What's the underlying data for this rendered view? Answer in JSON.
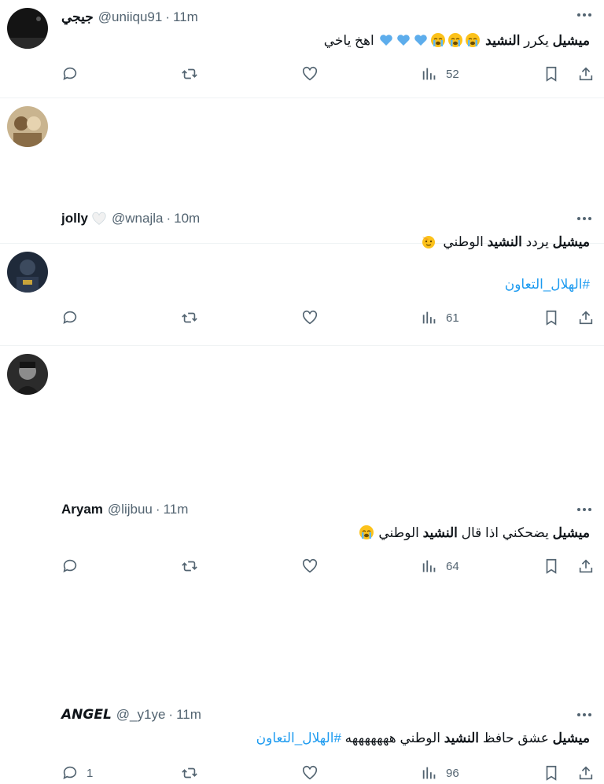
{
  "tweets": [
    {
      "name": "جيجي",
      "handle": "@uniiqu91",
      "time": "11m",
      "text_bold": "ميشيل",
      "text_mid": " يكرر ",
      "text_bold2": "النشيد",
      "text_tail": " اهخ ياخي",
      "emojis": [
        "crying-face-icon",
        "crying-face-icon",
        "crying-face-icon",
        "blue-heart-icon",
        "blue-heart-icon",
        "blue-heart-icon"
      ],
      "replies": "",
      "views": "52"
    },
    {
      "name": "jolly",
      "handle": "@wnajla",
      "time": "10m",
      "text_bold": "ميشيل",
      "text_mid": " يردد ",
      "text_bold2": "النشيد",
      "text_tail": " الوطني",
      "emojis": [
        "saluting-face-icon"
      ],
      "hashtag": "#الهلال_التعاون",
      "replies": "",
      "views": "61"
    },
    {
      "name": "Aryam",
      "handle": "@lijbuu",
      "time": "11m",
      "text_bold": "ميشيل",
      "text_mid": " يضحكني اذا قال ",
      "text_bold2": "النشيد",
      "text_tail": " الوطني",
      "emojis": [
        "crying-face-icon"
      ],
      "replies": "",
      "views": "64"
    },
    {
      "name": "𝘼𝙉𝙂𝙀𝙇",
      "handle": "@_y1ye",
      "time": "11m",
      "text_bold": "ميشيل",
      "text_mid": " عشق حافظ ",
      "text_bold2": "النشيد",
      "text_tail": " الوطني هههههههه ",
      "hashtag": "#الهلال_التعاون",
      "replies": "1",
      "views": "96"
    }
  ],
  "colors": {
    "text": "#0f1419",
    "muted": "#536471",
    "link": "#1d9bf0",
    "border": "#eff3f4"
  }
}
